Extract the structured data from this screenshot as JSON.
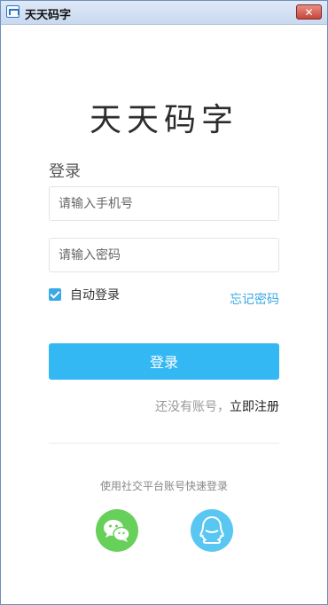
{
  "window": {
    "title": "天天码字",
    "close_glyph": "✕"
  },
  "brand": {
    "logo_text": "天天码字"
  },
  "login": {
    "heading": "登录",
    "phone_placeholder": "请输入手机号",
    "password_placeholder": "请输入密码",
    "auto_login_label": "自动登录",
    "auto_login_checked": true,
    "forgot_password": "忘记密码",
    "submit_label": "登录",
    "no_account_text": "还没有账号，",
    "register_link": "立即注册"
  },
  "social": {
    "label": "使用社交平台账号快速登录",
    "icons": [
      "wechat-icon",
      "qq-icon"
    ]
  },
  "colors": {
    "accent": "#34b8f4",
    "link": "#3aa8e6",
    "wechat": "#67d05a",
    "qq": "#59c7f2"
  }
}
